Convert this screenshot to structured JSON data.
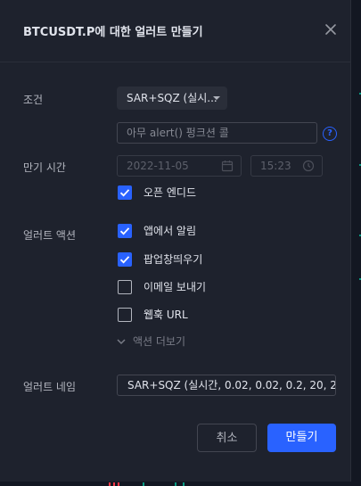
{
  "dialog": {
    "title": "BTCUSDT.P에 대한 얼러트 만들기"
  },
  "condition": {
    "label": "조건",
    "select_value": "SAR+SQZ (실시...",
    "alert_input_placeholder": "아무 alert() 펑크션 콜"
  },
  "expiration": {
    "label": "만기 시간",
    "date": "2022-11-05",
    "time": "15:23",
    "open_ended_label": "오픈 엔디드",
    "open_ended_checked": true
  },
  "actions": {
    "label": "얼러트 액션",
    "items": [
      {
        "label": "앱에서 알림",
        "checked": true
      },
      {
        "label": "팝업창띄우기",
        "checked": true
      },
      {
        "label": "이메일 보내기",
        "checked": false
      },
      {
        "label": "웹훅 URL",
        "checked": false
      }
    ],
    "more_label": "액션 더보기"
  },
  "alert_name": {
    "label": "얼러트 네임",
    "value": "SAR+SQZ (실시간, 0.02, 0.02, 0.2, 20, 2, 2"
  },
  "buttons": {
    "cancel": "취소",
    "create": "만들기"
  },
  "colors": {
    "accent": "#2962ff",
    "dialog_bg": "#1e222d",
    "page_bg": "#131722"
  }
}
